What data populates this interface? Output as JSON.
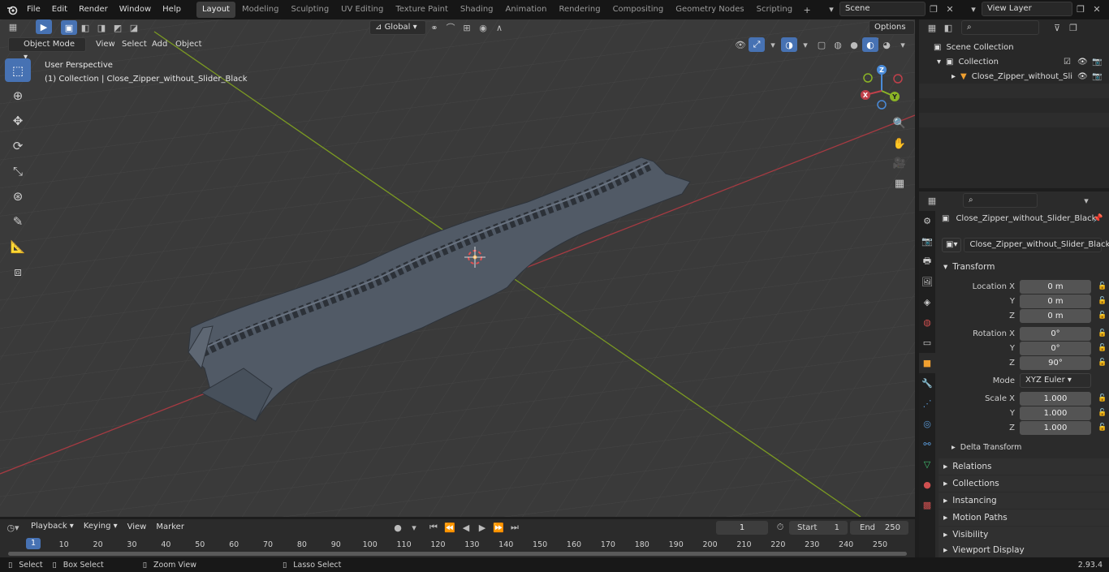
{
  "topbar": {
    "menus": [
      "File",
      "Edit",
      "Render",
      "Window",
      "Help"
    ],
    "workspaces": [
      "Layout",
      "Modeling",
      "Sculpting",
      "UV Editing",
      "Texture Paint",
      "Shading",
      "Animation",
      "Rendering",
      "Compositing",
      "Geometry Nodes",
      "Scripting"
    ],
    "active_workspace": "Layout",
    "scene": "Scene",
    "view_layer": "View Layer"
  },
  "viewport": {
    "mode": "Object Mode",
    "menus": [
      "View",
      "Select",
      "Add",
      "Object"
    ],
    "transform_orientation": "Global",
    "options_label": "Options",
    "perspective_label": "User Perspective",
    "collection_label": "(1) Collection | Close_Zipper_without_Slider_Black",
    "gizmo": {
      "x": "X",
      "y": "Y",
      "z": "Z"
    }
  },
  "outliner": {
    "scene_collection": "Scene Collection",
    "collection": "Collection",
    "object": "Close_Zipper_without_Sli"
  },
  "properties": {
    "object_name": "Close_Zipper_without_Slider_Black",
    "data_name": "Close_Zipper_without_Slider_Black",
    "transform_title": "Transform",
    "location_label": "Location X",
    "rotation_label": "Rotation X",
    "scale_label": "Scale X",
    "y_label": "Y",
    "z_label": "Z",
    "location": [
      "0 m",
      "0 m",
      "0 m"
    ],
    "rotation": [
      "0°",
      "0°",
      "90°"
    ],
    "mode_label": "Mode",
    "mode_value": "XYZ Euler",
    "scale": [
      "1.000",
      "1.000",
      "1.000"
    ],
    "delta_transform": "Delta Transform",
    "panels": [
      "Relations",
      "Collections",
      "Instancing",
      "Motion Paths",
      "Visibility",
      "Viewport Display"
    ]
  },
  "timeline": {
    "menus": [
      "Playback",
      "Keying",
      "View",
      "Marker"
    ],
    "current_frame": "1",
    "start_label": "Start",
    "start_value": "1",
    "end_label": "End",
    "end_value": "250",
    "ruler_labels": [
      "1",
      "10",
      "20",
      "30",
      "40",
      "50",
      "60",
      "70",
      "80",
      "90",
      "100",
      "110",
      "120",
      "130",
      "140",
      "150",
      "160",
      "170",
      "180",
      "190",
      "200",
      "210",
      "220",
      "230",
      "240",
      "250"
    ],
    "ruler_values": [
      1,
      10,
      20,
      30,
      40,
      50,
      60,
      70,
      80,
      90,
      100,
      110,
      120,
      130,
      140,
      150,
      160,
      170,
      180,
      190,
      200,
      210,
      220,
      230,
      240,
      250
    ]
  },
  "statusbar": {
    "select": "Select",
    "box_select": "Box Select",
    "zoom_view": "Zoom View",
    "lasso_select": "Lasso Select",
    "version": "2.93.4"
  },
  "colors": {
    "accent": "#4772b3",
    "x_axis": "#c0404a",
    "y_axis": "#8bb326",
    "z_axis": "#4a8bd9"
  }
}
